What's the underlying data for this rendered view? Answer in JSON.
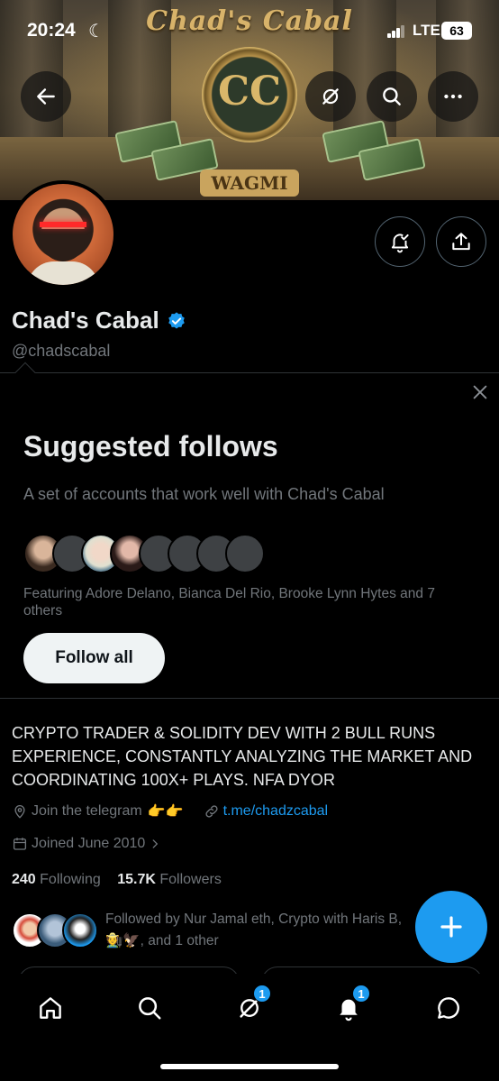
{
  "status_bar": {
    "time": "20:24",
    "network": "LTE",
    "battery": "63"
  },
  "banner": {
    "art_title": "Chad's Cabal",
    "art_badge": "WAGMI",
    "emblem_text": "CC"
  },
  "profile": {
    "name": "Chad's Cabal",
    "handle": "@chadscabal",
    "bio": "CRYPTO TRADER & SOLIDITY DEV WITH 2 BULL RUNS EXPERIENCE, CONSTANTLY ANALYZING THE MARKET AND COORDINATING 100X+ PLAYS. NFA DYOR",
    "location": "Join the telegram",
    "location_emoji": "👉👉",
    "website": "t.me/chadzcabal",
    "joined": "Joined June 2010",
    "following_count": "240",
    "following_label": "Following",
    "followers_count": "15.7K",
    "followers_label": "Followers",
    "followed_by": "Followed by Nur Jamal eth, Crypto with Haris B, ",
    "followed_by_emoji": "🧑‍🌾🦅",
    "followed_by_more": ", and 1 other"
  },
  "suggested": {
    "title": "Suggested follows",
    "subtitle": "A set of accounts that work well with Chad's Cabal",
    "featuring": "Featuring Adore Delano, Bianca Del Rio, Brooke Lynn Hytes and 7 others",
    "follow_all_label": "Follow all"
  },
  "tabs": [
    {
      "name": "home",
      "badge": ""
    },
    {
      "name": "search",
      "badge": ""
    },
    {
      "name": "grok",
      "badge": "1"
    },
    {
      "name": "notifications",
      "badge": "1"
    },
    {
      "name": "messages",
      "badge": ""
    }
  ],
  "colors": {
    "accent": "#1d9bf0",
    "muted": "#71767b",
    "text": "#e7e9ea",
    "background": "#000000"
  }
}
